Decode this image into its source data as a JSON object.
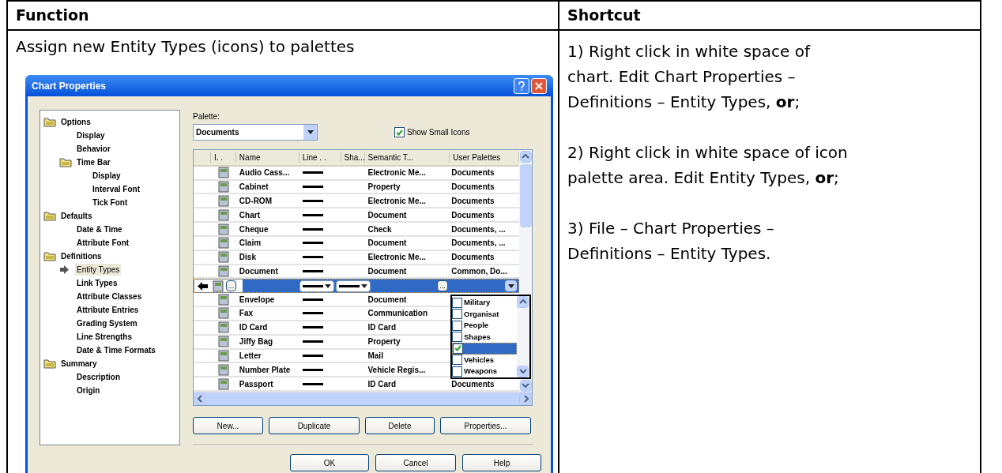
{
  "document": {
    "columns": [
      "Function",
      "Shortcut"
    ],
    "function_title": "Assign new Entity Types (icons) to palettes",
    "steps": [
      {
        "lines": [
          "1) Right click in white space of",
          "chart. Edit Chart Properties –",
          "Definitions – Entity Types, **or**;"
        ]
      },
      {
        "lines": [
          "2) Right click in white space of icon",
          "palette area. Edit Entity Types, **or**;"
        ]
      },
      {
        "lines": [
          "3) File – Chart Properties –",
          "Definitions – Entity Types."
        ]
      }
    ]
  },
  "dialog": {
    "title": "Chart Properties",
    "tree": [
      {
        "label": "Options",
        "selected": false,
        "children": [
          {
            "label": "Display",
            "selected": false
          },
          {
            "label": "Behavior",
            "selected": false
          },
          {
            "label": "Time Bar",
            "selected": false,
            "children": [
              {
                "label": "Display",
                "selected": false
              },
              {
                "label": "Interval Font",
                "selected": false
              },
              {
                "label": "Tick Font",
                "selected": false
              }
            ]
          }
        ]
      },
      {
        "label": "Defaults",
        "selected": false,
        "children": [
          {
            "label": "Date & Time",
            "selected": false
          },
          {
            "label": "Attribute Font",
            "selected": false
          }
        ]
      },
      {
        "label": "Definitions",
        "selected": false,
        "children": [
          {
            "label": "Entity Types",
            "selected": true
          },
          {
            "label": "Link Types",
            "selected": false
          },
          {
            "label": "Attribute Classes",
            "selected": false
          },
          {
            "label": "Attribute Entries",
            "selected": false
          },
          {
            "label": "Grading System",
            "selected": false
          },
          {
            "label": "Line Strengths",
            "selected": false
          },
          {
            "label": "Date & Time Formats",
            "selected": false
          }
        ]
      },
      {
        "label": "Summary",
        "selected": false,
        "children": [
          {
            "label": "Description",
            "selected": false
          },
          {
            "label": "Origin",
            "selected": false
          }
        ]
      }
    ],
    "palette": {
      "label": "Palette:",
      "value": "Documents"
    },
    "show_small_icons": {
      "label": "Show Small Icons",
      "checked": true
    },
    "table": {
      "columns": [
        "I. .",
        "Name",
        "Line . .",
        "Sha...",
        "Semantic T...",
        "User Palettes"
      ],
      "rows": [
        {
          "name": "Audio Cass...",
          "semantic_type": "Electronic Me...",
          "user_palettes": "Documents",
          "selected": false
        },
        {
          "name": "Cabinet",
          "semantic_type": "Property",
          "user_palettes": "Documents",
          "selected": false
        },
        {
          "name": "CD-ROM",
          "semantic_type": "Electronic Me...",
          "user_palettes": "Documents",
          "selected": false
        },
        {
          "name": "Chart",
          "semantic_type": "Document",
          "user_palettes": "Documents",
          "selected": false
        },
        {
          "name": "Cheque",
          "semantic_type": "Check",
          "user_palettes": "Documents, ...",
          "selected": false
        },
        {
          "name": "Claim",
          "semantic_type": "Document",
          "user_palettes": "Documents, ...",
          "selected": false
        },
        {
          "name": "Disk",
          "semantic_type": "Electronic Me...",
          "user_palettes": "Documents",
          "selected": false
        },
        {
          "name": "Document",
          "semantic_type": "Document",
          "user_palettes": "Common, Do...",
          "selected": false
        },
        {
          "icon_button": "...",
          "semantic_button": "...",
          "selected": true
        },
        {
          "name": "Envelope",
          "semantic_type": "Document",
          "selected": false
        },
        {
          "name": "Fax",
          "semantic_type": "Communication",
          "selected": false
        },
        {
          "name": "ID Card",
          "semantic_type": "ID Card",
          "selected": false
        },
        {
          "name": "Jiffy Bag",
          "semantic_type": "Property",
          "selected": false
        },
        {
          "name": "Letter",
          "semantic_type": "Mail",
          "selected": false
        },
        {
          "name": "Number Plate",
          "semantic_type": "Vehicle Regis...",
          "selected": false
        },
        {
          "name": "Passport",
          "semantic_type": "ID Card",
          "user_palettes": "Documents",
          "selected": false
        }
      ]
    },
    "palette_dropdown": [
      {
        "label": "Military",
        "checked": false,
        "selected": false
      },
      {
        "label": "Organisat",
        "checked": false,
        "selected": false
      },
      {
        "label": "People",
        "checked": false,
        "selected": false
      },
      {
        "label": "Shapes",
        "checked": false,
        "selected": false
      },
      {
        "checked": true,
        "selected": true
      },
      {
        "label": "Vehicles",
        "checked": false,
        "selected": false
      },
      {
        "label": "Weapons",
        "checked": false,
        "selected": false
      }
    ],
    "actions": [
      "New...",
      "Duplicate",
      "Delete",
      "Properties..."
    ],
    "footer_buttons": [
      "OK",
      "Cancel",
      "Help"
    ]
  }
}
